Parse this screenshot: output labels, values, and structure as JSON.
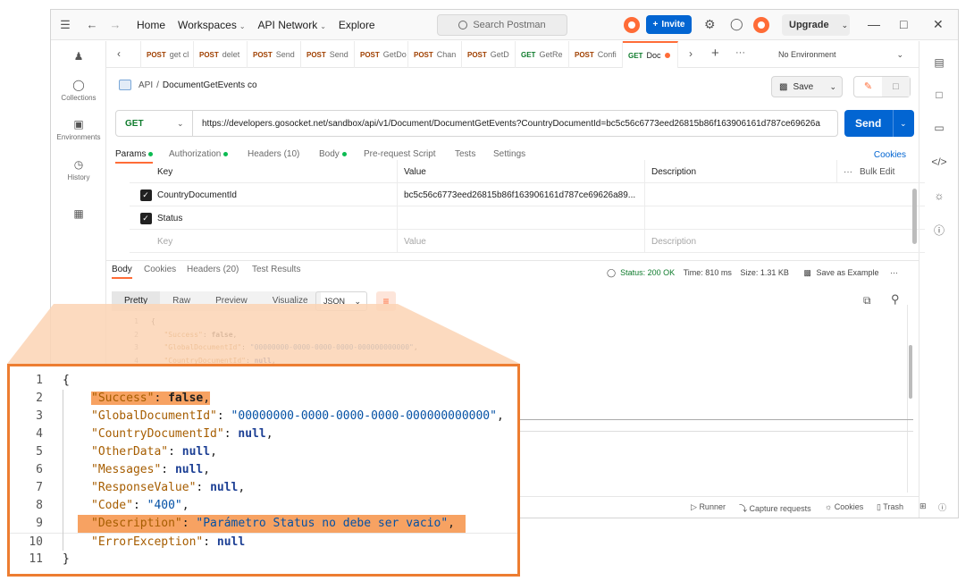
{
  "titlebar": {
    "nav": [
      "Home",
      "Workspaces",
      "API Network",
      "Explore"
    ],
    "search_placeholder": "Search Postman",
    "invite_label": "Invite",
    "upgrade_label": "Upgrade"
  },
  "sidebar": {
    "items": [
      {
        "label": "",
        "icon": "users-icon"
      },
      {
        "label": "Collections",
        "icon": "collections-icon"
      },
      {
        "label": "Environments",
        "icon": "environments-icon"
      },
      {
        "label": "History",
        "icon": "history-icon"
      },
      {
        "label": "",
        "icon": "apps-icon"
      }
    ]
  },
  "tabs": [
    {
      "method": "POST",
      "name": "get cl"
    },
    {
      "method": "POST",
      "name": "delet"
    },
    {
      "method": "POST",
      "name": "Send"
    },
    {
      "method": "POST",
      "name": "Send"
    },
    {
      "method": "POST",
      "name": "GetDo"
    },
    {
      "method": "POST",
      "name": "Chan"
    },
    {
      "method": "POST",
      "name": "GetD"
    },
    {
      "method": "GET",
      "name": "GetRe"
    },
    {
      "method": "POST",
      "name": "Confi"
    },
    {
      "method": "GET",
      "name": "Doc",
      "active": true
    }
  ],
  "environment": "No Environment",
  "breadcrumb": {
    "root": "API",
    "separator": "/",
    "name": "DocumentGetEvents co"
  },
  "save_label": "Save",
  "request": {
    "method": "GET",
    "url": "https://developers.gosocket.net/sandbox/api/v1/Document/DocumentGetEvents?CountryDocumentId=bc5c56c6773eed26815b86f163906161d787ce69626a",
    "send_label": "Send"
  },
  "request_tabs": [
    "Params",
    "Authorization",
    "Headers (10)",
    "Body",
    "Pre-request Script",
    "Tests",
    "Settings"
  ],
  "cookies_label": "Cookies",
  "params": {
    "headers": [
      "Key",
      "Value",
      "Description"
    ],
    "bulk_edit": "Bulk Edit",
    "rows": [
      {
        "key": "CountryDocumentId",
        "value": "bc5c56c6773eed26815b86f163906161d787ce69626a89...",
        "description": "",
        "checked": true
      },
      {
        "key": "Status",
        "value": "",
        "description": "",
        "checked": true
      }
    ],
    "placeholder": {
      "key": "Key",
      "value": "Value",
      "description": "Description"
    }
  },
  "response_tabs": [
    "Body",
    "Cookies",
    "Headers (20)",
    "Test Results"
  ],
  "response_meta": {
    "status": "Status: 200 OK",
    "time": "Time: 810 ms",
    "size": "Size: 1.31 KB",
    "save_example": "Save as Example"
  },
  "view_modes": [
    "Pretty",
    "Raw",
    "Preview",
    "Visualize"
  ],
  "format": "JSON",
  "status_bar": [
    "Runner",
    "Capture requests",
    "Cookies",
    "Trash"
  ],
  "zoom_lines": [
    {
      "n": "1",
      "text": "{"
    },
    {
      "n": "2",
      "key": "\"Success\"",
      "val": "false",
      "vtype": "b",
      "comma": true,
      "hl": "key"
    },
    {
      "n": "3",
      "key": "\"GlobalDocumentId\"",
      "val": "\"00000000-0000-0000-0000-000000000000\"",
      "vtype": "s",
      "comma": true
    },
    {
      "n": "4",
      "key": "\"CountryDocumentId\"",
      "val": "null",
      "vtype": "n",
      "comma": true
    },
    {
      "n": "5",
      "key": "\"OtherData\"",
      "val": "null",
      "vtype": "n",
      "comma": true
    },
    {
      "n": "6",
      "key": "\"Messages\"",
      "val": "null",
      "vtype": "n",
      "comma": true
    },
    {
      "n": "7",
      "key": "\"ResponseValue\"",
      "val": "null",
      "vtype": "n",
      "comma": true
    },
    {
      "n": "8",
      "key": "\"Code\"",
      "val": "\"400\"",
      "vtype": "s",
      "comma": true
    },
    {
      "n": "9",
      "key": "\"Description\"",
      "val": "\"Parámetro Status no debe ser vacio\"",
      "vtype": "s",
      "comma": true,
      "hl": "line"
    },
    {
      "n": "10",
      "key": "\"ErrorException\"",
      "val": "null",
      "vtype": "n",
      "comma": false
    },
    {
      "n": "11",
      "text": "}"
    }
  ]
}
